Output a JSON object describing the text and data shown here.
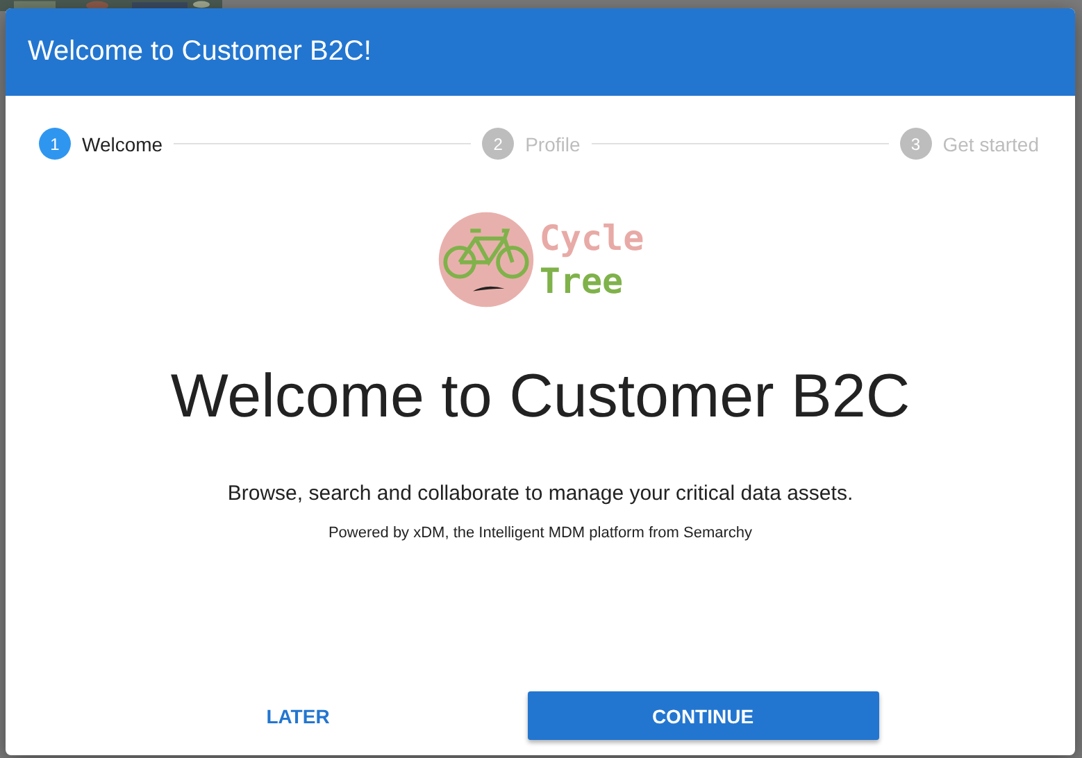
{
  "dialog": {
    "title": "Welcome to Customer B2C!",
    "steps": [
      {
        "number": "1",
        "label": "Welcome",
        "selected": true
      },
      {
        "number": "2",
        "label": "Profile",
        "selected": false
      },
      {
        "number": "3",
        "label": "Get started",
        "selected": false
      }
    ],
    "logo": {
      "line_1": "Cycle",
      "line_2": "Tree"
    },
    "heading": "Welcome to Customer B2C",
    "description": "Browse, search and collaborate to manage your critical data assets.",
    "footnote": "Powered by xDM, the Intelligent MDM platform from Semarchy",
    "buttons": [
      {
        "label": "LATER",
        "kind": "text"
      },
      {
        "label": "CONTINUE",
        "kind": "primary"
      }
    ]
  }
}
